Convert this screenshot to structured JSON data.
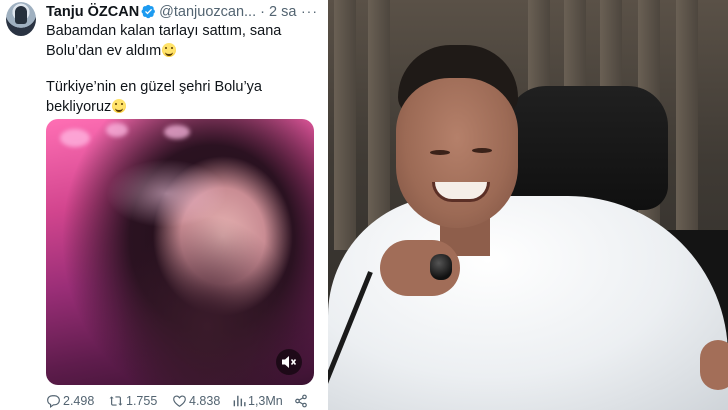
{
  "tweet": {
    "author_name": "Tanju ÖZCAN",
    "handle": "@tanjuozcan...",
    "separator": "·",
    "time": "2 sa",
    "more_label": "···",
    "text_line_1": "Babamdan kalan tarlayı sattım, sana",
    "text_line_2": "Bolu’dan ev aldım",
    "text_line_3": "Türkiye’nin en güzel şehri Bolu’ya",
    "text_line_4": "bekliyoruz",
    "emoji_icons": [
      "grinning-face-emoji",
      "smiling-face-emoji"
    ],
    "media": {
      "type": "video",
      "muted": true
    },
    "actions": {
      "replies": "2.498",
      "retweets": "1.755",
      "likes": "4.838",
      "views": "1,3Mn"
    },
    "colors": {
      "verified_blue": "#1d9bf0",
      "text": "#0f1419",
      "muted_text": "#536471"
    }
  },
  "photo": {
    "subject": "photo-man-laughing-at-microphone"
  }
}
